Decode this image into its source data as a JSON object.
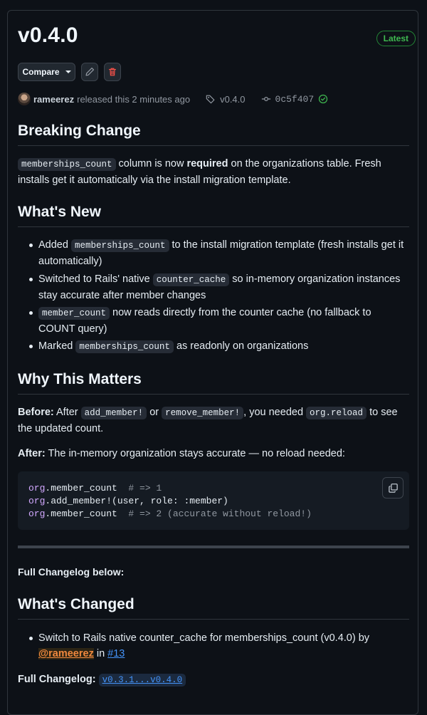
{
  "release": {
    "title": "v0.4.0",
    "badge": "Latest",
    "compare_label": "Compare",
    "author": "rameerez",
    "released_text": "released this 2 minutes ago",
    "tag": "v0.4.0",
    "commit": "0c5f407"
  },
  "sections": {
    "breaking": {
      "heading": "Breaking Change",
      "code": "memberships_count",
      "text_a": " column is now ",
      "bold": "required",
      "text_b": " on the organizations table. Fresh installs get it automatically via the install migration template."
    },
    "whats_new": {
      "heading": "What's New",
      "items": [
        {
          "a": "Added ",
          "code": "memberships_count",
          "b": " to the install migration template (fresh installs get it automatically)"
        },
        {
          "a": "Switched to Rails' native ",
          "code": "counter_cache",
          "b": " so in-memory organization instances stay accurate after member changes"
        },
        {
          "a": "",
          "code": "member_count",
          "b": " now reads directly from the counter cache (no fallback to COUNT query)"
        },
        {
          "a": "Marked ",
          "code": "memberships_count",
          "b": " as readonly on organizations"
        }
      ]
    },
    "why": {
      "heading": "Why This Matters",
      "before_label": "Before:",
      "before_a": " After ",
      "before_code1": "add_member!",
      "before_b": " or ",
      "before_code2": "remove_member!",
      "before_c": ", you needed ",
      "before_code3": "org.reload",
      "before_d": " to see the updated count.",
      "after_label": "After:",
      "after_text": " The in-memory organization stays accurate — no reload needed:",
      "code_lines": [
        {
          "obj": "org",
          "rest": ".member_count",
          "comment": "  # => 1"
        },
        {
          "obj": "org",
          "rest": ".add_member!(user, role: :member)",
          "comment": ""
        },
        {
          "obj": "org",
          "rest": ".member_count",
          "comment": "  # => 2 (accurate without reload!)"
        }
      ]
    },
    "full_changelog_below": "Full Changelog below:",
    "whats_changed": {
      "heading": "What's Changed",
      "item_text": "Switch to Rails native counter_cache for memberships_count (v0.4.0) by ",
      "mention": "@rameerez",
      "in_text": " in ",
      "pr_link": "#13"
    },
    "changelog": {
      "label": "Full Changelog:",
      "link": "v0.3.1...v0.4.0"
    }
  }
}
